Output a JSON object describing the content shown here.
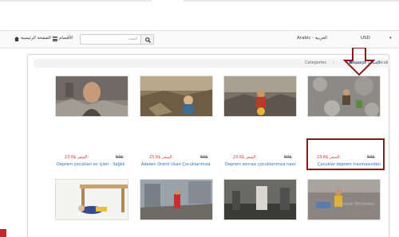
{
  "nav": {
    "home": "الصفحة الرئيسية",
    "categories": "الأقسام",
    "search_placeholder": "البحث",
    "language": "Arabic - العربية",
    "currency": "USD"
  },
  "breadcrumb": {
    "home": "الصفحة الرئيسية",
    "items": [
      "Categories",
      "deprem",
      "çocuk"
    ]
  },
  "products_row1": [
    {
      "title": "Deprem çocukları ev içleri - Sağlık",
      "price_label": "السعر:",
      "price": "23.6$",
      "old_price": "50$"
    },
    {
      "title": "Adeleni Örenti Usan Çocuklarımıza",
      "price_label": "السعر:",
      "price": "23.6$",
      "old_price": "50$"
    },
    {
      "title": "Deprem sonrası çocuklarımıza nasıl",
      "price_label": "السعر:",
      "price": "23.6$",
      "old_price": "50$"
    },
    {
      "title": "Çocuklar deprem travmasından",
      "price_label": "السعر:",
      "price": "23.6$",
      "old_price": "50$"
    }
  ],
  "watermark": "Activate Windows",
  "colors": {
    "price": "#e03a3a",
    "link": "#2a6fb5",
    "highlight": "#8b1a1a"
  }
}
